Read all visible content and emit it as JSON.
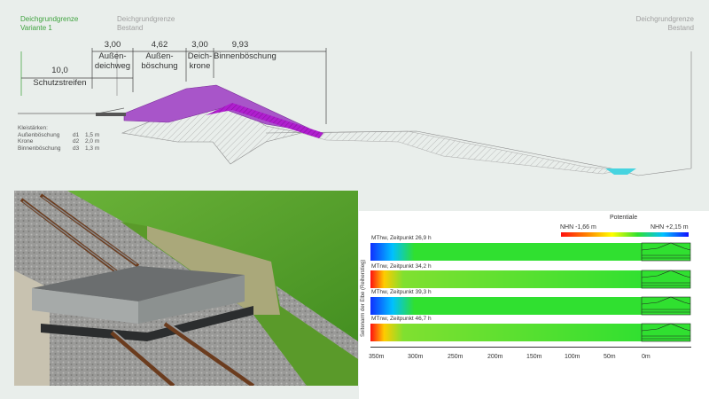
{
  "header": {
    "variant_title_line1": "Deichgrundgrenze",
    "variant_title_line2": "Variante 1",
    "existing_left_line1": "Deichgrundgrenze",
    "existing_left_line2": "Bestand",
    "existing_right_line1": "Deichgrundgrenze",
    "existing_right_line2": "Bestand"
  },
  "dimensions": [
    {
      "value": "10,0",
      "label": "Schutzstreifen"
    },
    {
      "value": "3,00",
      "label_line1": "Außen-",
      "label_line2": "deichweg"
    },
    {
      "value": "4,62",
      "label_line1": "Außen-",
      "label_line2": "böschung"
    },
    {
      "value": "3,00",
      "label_line1": "Deich-",
      "label_line2": "krone"
    },
    {
      "value": "9,93",
      "label": "Binnenböschung"
    }
  ],
  "thickness": {
    "title": "Kleistärken:",
    "rows": [
      {
        "name": "Außenböschung",
        "code": "d1",
        "value": "1,5 m"
      },
      {
        "name": "Krone",
        "code": "d2",
        "value": "2,0 m"
      },
      {
        "name": "Binnenböschung",
        "code": "d3",
        "value": "1,3 m"
      }
    ]
  },
  "potential_panel": {
    "legend_title": "Potentiale",
    "legend_min": "NHN -1,66 m",
    "legend_max": "NHN +2,15 m",
    "y_axis_label": "Seitenarm der Elbe (Reiherstieg)",
    "rows": [
      {
        "label": "MThw, Zeitpunkt 26,9 h"
      },
      {
        "label": "MTnw, Zeitpunkt 34,2 h"
      },
      {
        "label": "MThw, Zeitpunkt 39,3 h"
      },
      {
        "label": "MTnw, Zeitpunkt 46,7 h"
      }
    ],
    "x_ticks": [
      "350m",
      "300m",
      "250m",
      "200m",
      "150m",
      "100m",
      "50m",
      "0m"
    ]
  },
  "colors": {
    "dike_purple": "#a855c9",
    "dike_magenta": "#b01ecf",
    "water_cyan": "#47d4e0",
    "field_green": "#3ed83a",
    "grass_green": "#5aa82a",
    "background": "#e9eeeb"
  }
}
